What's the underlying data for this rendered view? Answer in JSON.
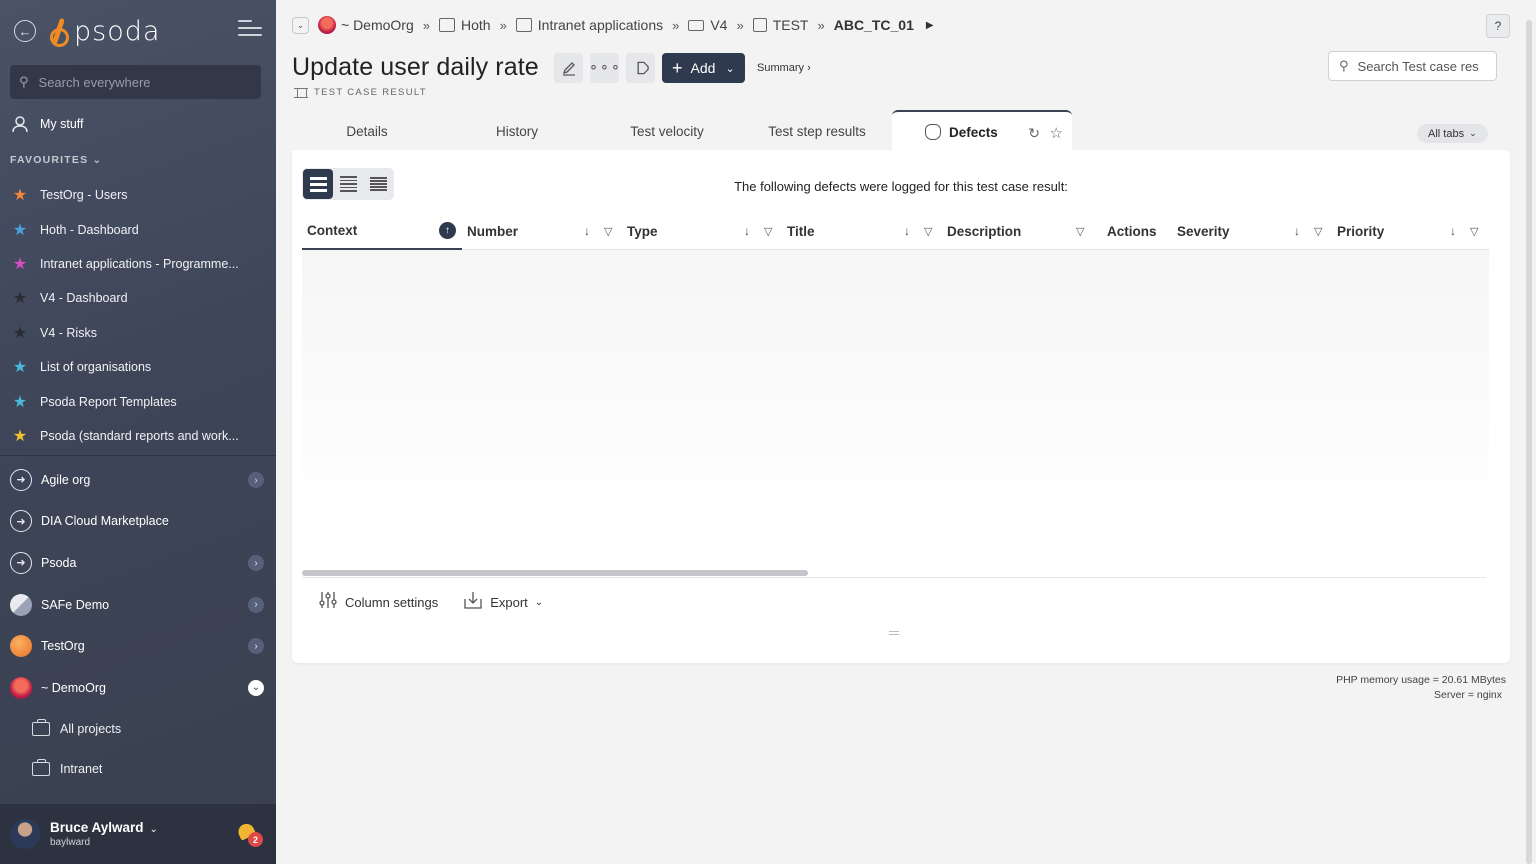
{
  "sidebar": {
    "logo_text": "psoda",
    "search_placeholder": "Search everywhere",
    "my_stuff": "My stuff",
    "favourites_heading": "FAVOURITES",
    "favourites": [
      {
        "label": "TestOrg - Users",
        "star_color": "#f0883a"
      },
      {
        "label": "Hoth - Dashboard",
        "star_color": "#4aa3df"
      },
      {
        "label": "Intranet applications - Programme...",
        "star_color": "#d64fc5"
      },
      {
        "label": "V4 - Dashboard",
        "star_color": "#2a2d35"
      },
      {
        "label": "V4 - Risks",
        "star_color": "#2a2d35"
      },
      {
        "label": "List of organisations",
        "star_color": "#48b8d8"
      },
      {
        "label": "Psoda Report Templates",
        "star_color": "#48b8d8"
      },
      {
        "label": "Psoda (standard reports and work...",
        "star_color": "#f2c12e"
      }
    ],
    "orgs": [
      {
        "label": "Agile org",
        "expandable": true,
        "expanded": false
      },
      {
        "label": "DIA Cloud Marketplace",
        "expandable": false,
        "expanded": false
      },
      {
        "label": "Psoda",
        "expandable": true,
        "expanded": false
      },
      {
        "label": "SAFe Demo",
        "expandable": true,
        "expanded": false
      },
      {
        "label": "TestOrg",
        "expandable": true,
        "expanded": false
      },
      {
        "label": "~ DemoOrg",
        "expandable": true,
        "expanded": true
      }
    ],
    "sub_items": [
      {
        "label": "All projects"
      },
      {
        "label": "Intranet"
      }
    ],
    "user": {
      "name": "Bruce Aylward",
      "login": "baylward",
      "notifications": "2"
    }
  },
  "breadcrumb": {
    "items": [
      "~ DemoOrg",
      "Hoth",
      "Intranet applications",
      "V4",
      "TEST"
    ],
    "current": "ABC_TC_01"
  },
  "header": {
    "title": "Update user daily rate",
    "subtitle": "TEST CASE RESULT",
    "add_label": "Add",
    "summary_label": "Summary ›",
    "search_placeholder": "Search Test case res",
    "help_label": "?"
  },
  "tabs": {
    "items": [
      "Details",
      "History",
      "Test velocity",
      "Test step results"
    ],
    "active": "Defects",
    "all_tabs_label": "All tabs"
  },
  "panel": {
    "message": "The following defects were logged for this test case result:",
    "columns": [
      "Context",
      "Number",
      "Type",
      "Title",
      "Description",
      "Actions",
      "Severity",
      "Priority"
    ],
    "rows": [],
    "column_settings_label": "Column settings",
    "export_label": "Export"
  },
  "system_info": {
    "memory": "PHP memory usage = 20.61 MBytes",
    "server": "Server = nginx"
  }
}
